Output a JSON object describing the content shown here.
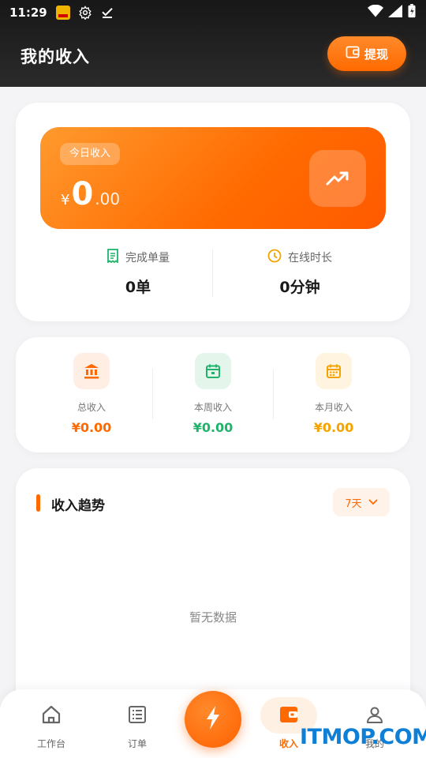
{
  "status": {
    "time": "11:29",
    "icons": [
      "app-badge-icon",
      "settings-icon",
      "check-icon",
      "wifi-icon",
      "signal-icon",
      "battery-charging-icon"
    ]
  },
  "header": {
    "title": "我的收入",
    "withdraw_label": "提现"
  },
  "today": {
    "label": "今日收入",
    "currency": "¥",
    "amount_int": "0",
    "amount_dec": ".00"
  },
  "stats": {
    "orders_label": "完成单量",
    "orders_value": "0单",
    "online_label": "在线时长",
    "online_value": "0分钟"
  },
  "summary": [
    {
      "label": "总收入",
      "value": "¥0.00",
      "color": "#ff6a00"
    },
    {
      "label": "本周收入",
      "value": "¥0.00",
      "color": "#1fb36b"
    },
    {
      "label": "本月收入",
      "value": "¥0.00",
      "color": "#f5a300"
    }
  ],
  "trend": {
    "title": "收入趋势",
    "range": "7天",
    "empty_text": "暂无数据"
  },
  "tabs": [
    {
      "label": "工作台",
      "icon": "home-icon"
    },
    {
      "label": "订单",
      "icon": "list-icon"
    },
    {
      "label": "",
      "icon": "lightning-icon"
    },
    {
      "label": "收入",
      "icon": "wallet-icon"
    },
    {
      "label": "我的",
      "icon": "user-icon"
    }
  ],
  "watermark": "ITMOP.COM",
  "colors": {
    "accent": "#ff6a00",
    "green": "#1fb36b",
    "yellow": "#f5a300"
  }
}
